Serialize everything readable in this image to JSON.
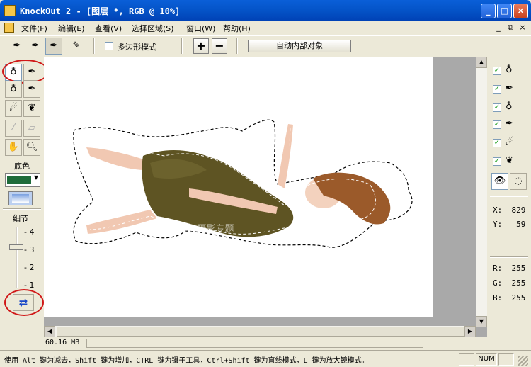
{
  "window": {
    "title": "KnockOut 2 - [图层 *, RGB @ 10%]",
    "minimize_glyph": "_",
    "maximize_glyph": "□",
    "close_glyph": "×"
  },
  "menu": {
    "items": [
      "文件(F)",
      "编辑(E)",
      "查看(V)",
      "选择区域(S)",
      "窗口(W)",
      "帮助(H)"
    ],
    "mdi_minimize": "_",
    "mdi_restore": "⧉",
    "mdi_close": "×"
  },
  "toolbar": {
    "polygon_mode_label": "多边形模式",
    "polygon_mode_checked": false,
    "plus_label": "+",
    "minus_label": "−",
    "auto_inner_object_label": "自动内部对象",
    "tools": [
      "inside-object-pen-icon",
      "outside-object-pen-icon",
      "inside-outside-pen-icon",
      "pencil-icon"
    ]
  },
  "left_panel": {
    "background_color_label": "底色",
    "background_color": "#1e6b3a",
    "detail_label": "细节",
    "detail_ticks": [
      "4",
      "3",
      "2",
      "1"
    ],
    "detail_value": 3,
    "annotation_color": "#d01818"
  },
  "right_panel": {
    "layers": [
      {
        "icon": "inside-brush-icon",
        "checked": true
      },
      {
        "icon": "outside-brush-icon",
        "checked": true
      },
      {
        "icon": "inside-object-pen-icon",
        "checked": true
      },
      {
        "icon": "outside-object-pen-icon",
        "checked": true
      },
      {
        "icon": "smart-pen-icon",
        "checked": true
      },
      {
        "icon": "feather-icon",
        "checked": true
      }
    ],
    "x_label": "X:",
    "x_value": "829",
    "y_label": "Y:",
    "y_value": "59",
    "r_label": "R:",
    "r_value": "255",
    "g_label": "G:",
    "g_value": "255",
    "b_label": "B:",
    "b_value": "255"
  },
  "canvas": {
    "watermark": "POCO 摄影专题"
  },
  "info": {
    "memory": "60.16 MB"
  },
  "status": {
    "hint": "使用 Alt 键为减去，Shift 键为增加，CTRL 键为镊子工具，Ctrl+Shift 键为直线模式，L 键为放大镜模式。",
    "num": "NUM"
  }
}
